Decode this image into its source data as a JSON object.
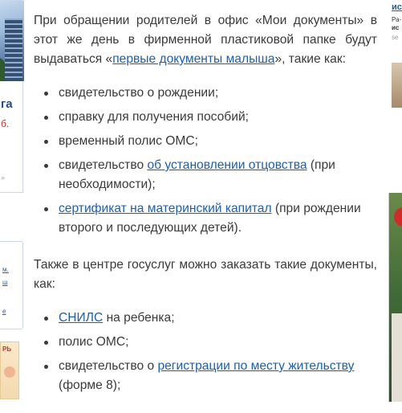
{
  "left_sidebar": {
    "promo_title": "га",
    "promo_sub": "б.",
    "promo_more": "»",
    "links": [
      "м.",
      "ш",
      "е"
    ],
    "book_label": "РЬ"
  },
  "article": {
    "intro": {
      "pre": "При обращении родителей в офис «Мои документы» в этот же день в фирменной пластиковой папке будут выдаваться «",
      "link": "первые документы малыша",
      "post": "», такие как:"
    },
    "list1": [
      {
        "pre": "свидетельство о рождении;",
        "link": "",
        "post": ""
      },
      {
        "pre": "справку для получения пособий;",
        "link": "",
        "post": ""
      },
      {
        "pre": "временный полис ОМС;",
        "link": "",
        "post": ""
      },
      {
        "pre": "свидетельство ",
        "link": "об установлении отцовства",
        "post": " (при необходимости);"
      },
      {
        "pre": "",
        "link": "сертификат на материнский капитал",
        "post": " (при рождении второго и последующих детей)."
      }
    ],
    "para2": "Также в центре госуслуг можно заказать такие документы, как:",
    "list2": [
      {
        "pre": "",
        "link": "СНИЛС",
        "post": " на ребенка;"
      },
      {
        "pre": "полис ОМС;",
        "link": "",
        "post": ""
      },
      {
        "pre": "свидетельство о ",
        "link": "регистрации по месту жительству",
        "post": " (форме 8);"
      }
    ]
  },
  "right_sidebar": {
    "ad_title": "ис",
    "ad_desc_1": "Ра-",
    "ad_desc_2": "ис",
    "ad_src": "se"
  },
  "colors": {
    "link": "#1a5fb4",
    "text": "#3a3a3a",
    "promo_title": "#1d4f8a",
    "promo_sub": "#d0312d"
  }
}
